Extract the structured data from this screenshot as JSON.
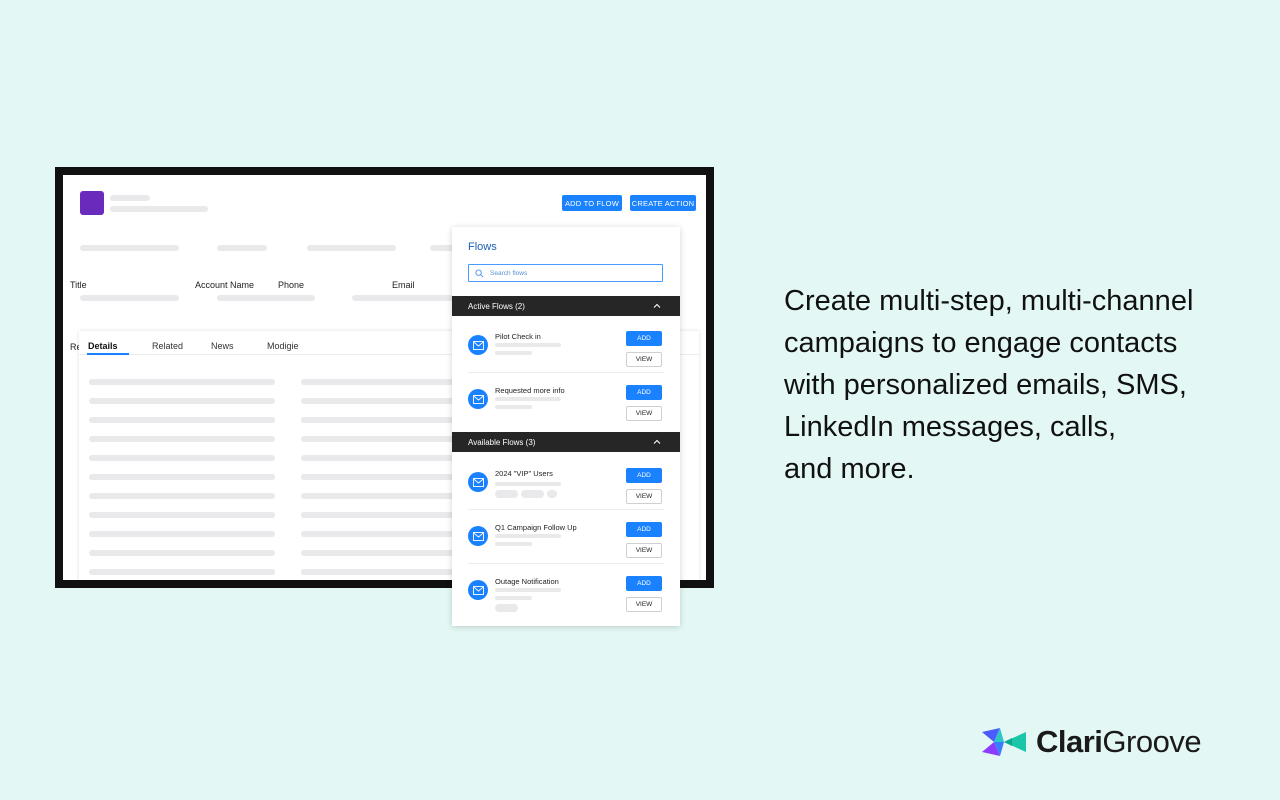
{
  "crm": {
    "add_to_flow_label": "ADD TO FLOW",
    "create_action_label": "CREATE ACTION",
    "fields": [
      "Title",
      "Account Name",
      "Phone",
      "Email"
    ],
    "partial_label": "Re",
    "tabs": [
      "Details",
      "Related",
      "News",
      "Modigie"
    ]
  },
  "flows_panel": {
    "title": "Flows",
    "search_placeholder": "Search flows",
    "active_section": "Active Flows (2)",
    "available_section": "Available Flows (3)",
    "add_label": "ADD",
    "view_label": "VIEW",
    "active_flows": [
      "Pilot Check in",
      "Requested more info"
    ],
    "available_flows": [
      "2024 \"VIP\" Users",
      "Q1 Campaign Follow Up",
      "Outage Notification"
    ]
  },
  "headline": {
    "lines": [
      "Create multi-step, multi-channel",
      "campaigns to engage contacts",
      "with personalized emails, SMS,",
      "LinkedIn messages, calls,",
      "and more."
    ]
  },
  "brand": {
    "part1": "Clari",
    "part2": "Groove"
  },
  "colors": {
    "background": "#e3f8f5",
    "accent": "#1a82ff",
    "logo_square": "#6a2bbd",
    "section_bar": "#262626"
  }
}
